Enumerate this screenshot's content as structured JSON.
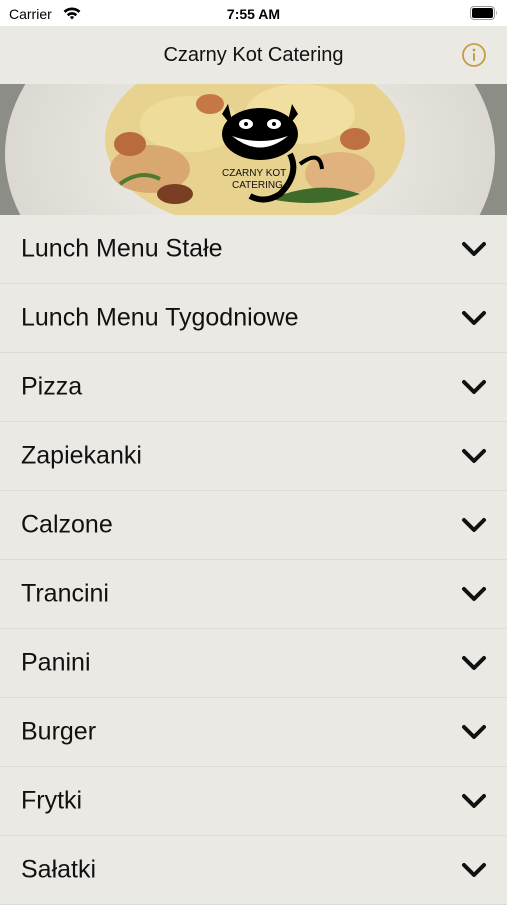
{
  "status_bar": {
    "carrier": "Carrier",
    "time": "7:55 AM"
  },
  "nav": {
    "title": "Czarny Kot Catering",
    "info_icon": "info-circle-icon",
    "accent_color": "#c79a45"
  },
  "hero": {
    "logo_text_line1": "CZARNY KOT",
    "logo_text_line2": "CATERING"
  },
  "menu": {
    "chevron_icon": "chevron-down-icon",
    "items": [
      {
        "label": "Lunch Menu Stałe"
      },
      {
        "label": "Lunch Menu Tygodniowe"
      },
      {
        "label": "Pizza"
      },
      {
        "label": "Zapiekanki"
      },
      {
        "label": "Calzone"
      },
      {
        "label": "Trancini"
      },
      {
        "label": "Panini"
      },
      {
        "label": "Burger"
      },
      {
        "label": "Frytki"
      },
      {
        "label": "Sałatki"
      }
    ]
  }
}
